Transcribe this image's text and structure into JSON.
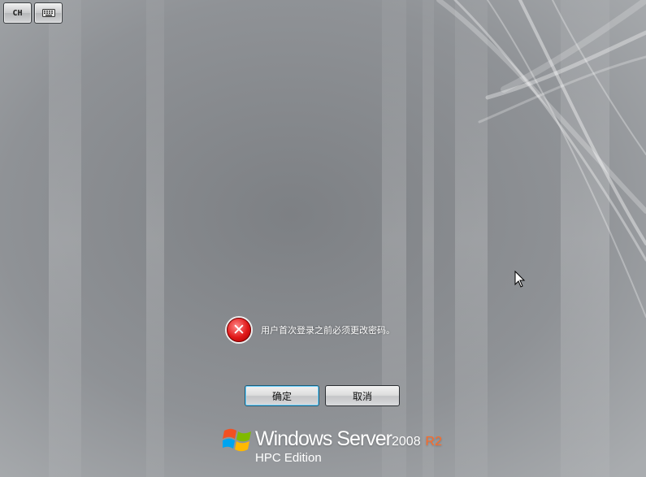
{
  "toolbar": {
    "language_label": "CH",
    "keyboard_icon": "on-screen-keyboard-icon"
  },
  "message": {
    "icon": "error-icon",
    "text": "用户首次登录之前必须更改密码。"
  },
  "buttons": {
    "ok_label": "确定",
    "cancel_label": "取消"
  },
  "branding": {
    "logo_icon": "windows-flag-icon",
    "product_name": "Windows Server",
    "version": "2008",
    "release": "R2",
    "edition": "HPC Edition"
  },
  "colors": {
    "background": "#8d9093",
    "release_accent": "#ff6b27",
    "focus_ring": "#6fd3ff",
    "error_red": "#e01818"
  }
}
